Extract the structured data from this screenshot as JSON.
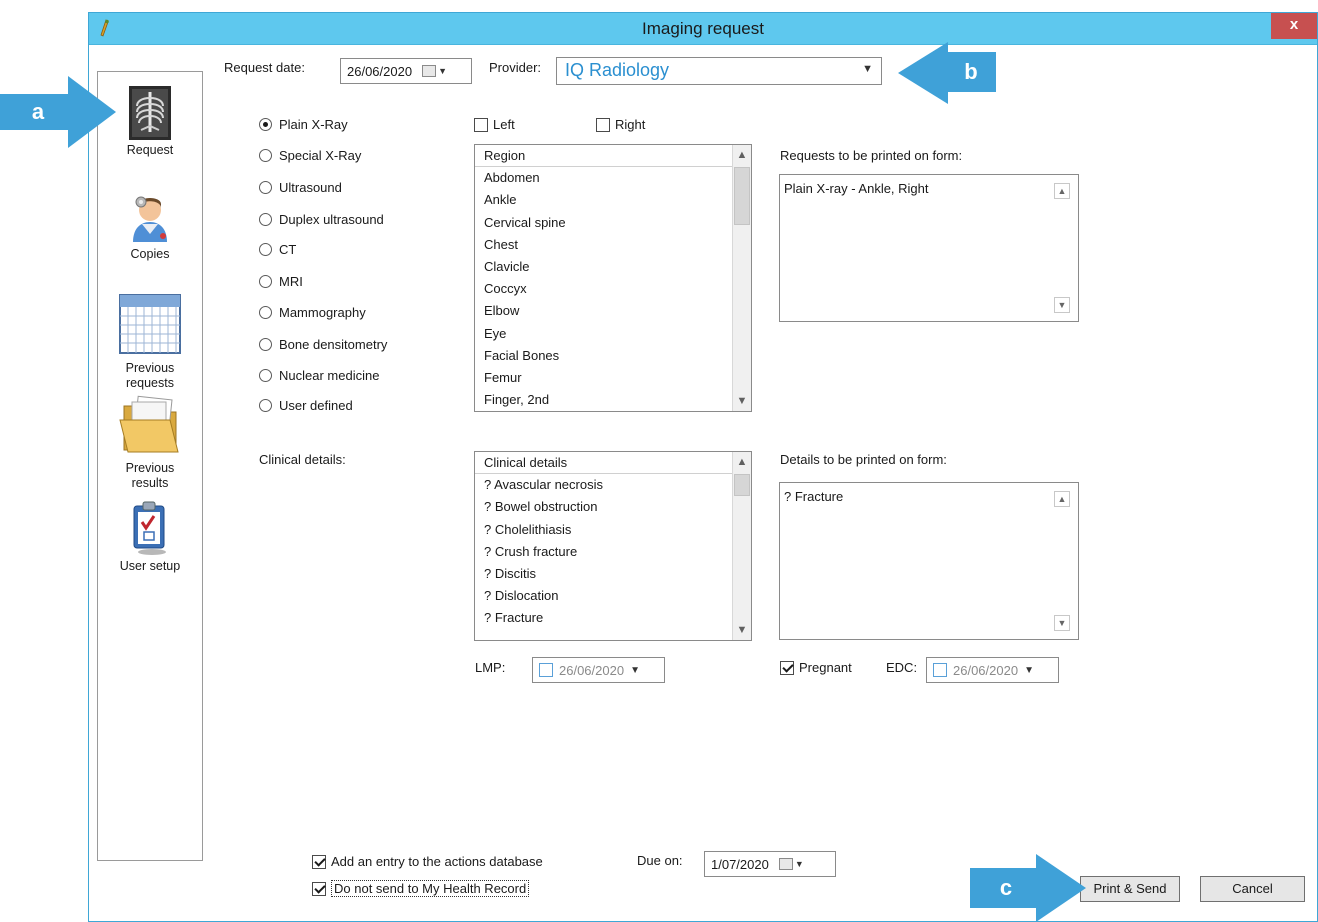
{
  "window": {
    "title": "Imaging request",
    "close_label": "x"
  },
  "nav": {
    "items": [
      {
        "label": "Request"
      },
      {
        "label": "Copies"
      },
      {
        "label": "Previous requests"
      },
      {
        "label": "Previous results"
      },
      {
        "label": "User setup"
      }
    ]
  },
  "header": {
    "request_date_label": "Request date:",
    "request_date_value": "26/06/2020",
    "provider_label": "Provider:",
    "provider_value": "IQ Radiology"
  },
  "imaging_types": [
    {
      "label": "Plain X-Ray",
      "selected": true
    },
    {
      "label": "Special X-Ray",
      "selected": false
    },
    {
      "label": "Ultrasound",
      "selected": false
    },
    {
      "label": "Duplex ultrasound",
      "selected": false
    },
    {
      "label": "CT",
      "selected": false
    },
    {
      "label": "MRI",
      "selected": false
    },
    {
      "label": "Mammography",
      "selected": false
    },
    {
      "label": "Bone densitometry",
      "selected": false
    },
    {
      "label": "Nuclear medicine",
      "selected": false
    },
    {
      "label": "User defined",
      "selected": false
    }
  ],
  "side": {
    "left_label": "Left",
    "left_checked": false,
    "right_label": "Right",
    "right_checked": false
  },
  "region_list": {
    "header": "Region",
    "items": [
      "Abdomen",
      "Ankle",
      "Cervical spine",
      "Chest",
      "Clavicle",
      "Coccyx",
      "Elbow",
      "Eye",
      "Facial Bones",
      "Femur",
      "Finger, 2nd"
    ]
  },
  "requests_printed": {
    "label": "Requests to be printed on form:",
    "value": "Plain X-ray - Ankle, Right"
  },
  "clinical": {
    "label": "Clinical details:",
    "header": "Clinical details",
    "items": [
      "? Avascular necrosis",
      "? Bowel obstruction",
      "? Cholelithiasis",
      "? Crush fracture",
      "? Discitis",
      "? Dislocation",
      "? Fracture"
    ]
  },
  "details_printed": {
    "label": "Details to be printed on form:",
    "value": "? Fracture"
  },
  "lmp": {
    "label": "LMP:",
    "value": "26/06/2020"
  },
  "pregnant": {
    "label": "Pregnant",
    "checked": true
  },
  "edc": {
    "label": "EDC:",
    "value": "26/06/2020"
  },
  "footer": {
    "add_action_label": "Add an entry to the actions database",
    "add_action_checked": true,
    "no_mhr_label": "Do not send to My Health Record",
    "no_mhr_checked": true,
    "due_on_label": "Due on:",
    "due_on_value": "1/07/2020",
    "print_send_label": "Print & Send",
    "cancel_label": "Cancel"
  },
  "callouts": {
    "a": "a",
    "b": "b",
    "c": "c"
  },
  "colors": {
    "titlebar": "#5ec8ee",
    "callout": "#3fa1d8",
    "provider_text": "#2a8fd0",
    "close": "#c75050"
  }
}
